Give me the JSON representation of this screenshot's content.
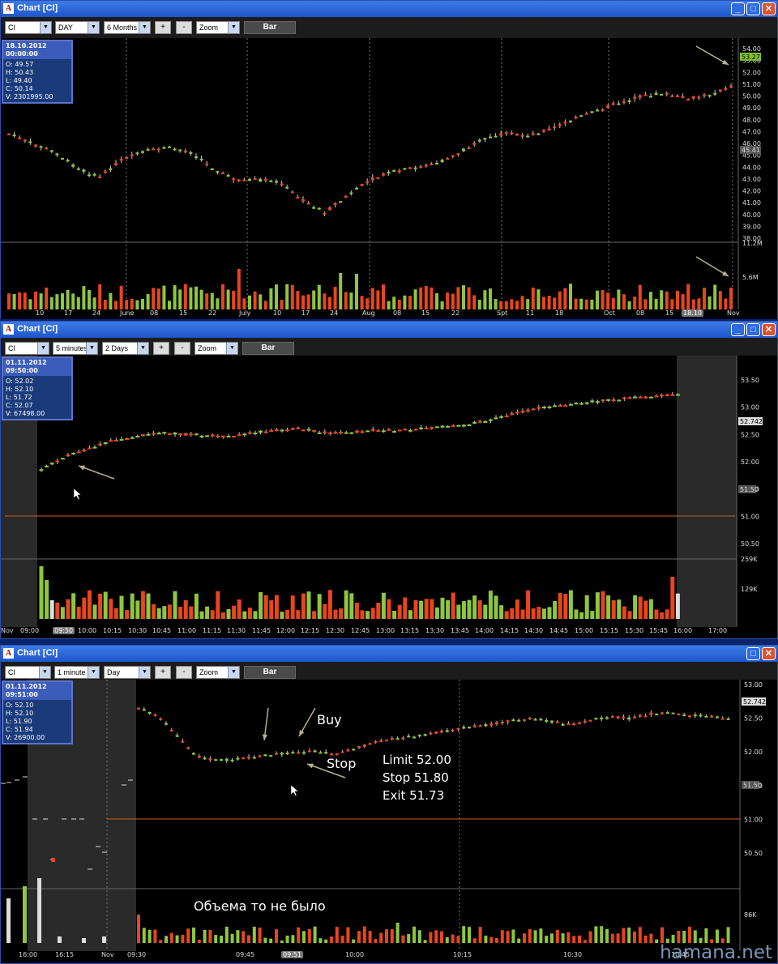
{
  "windows": [
    {
      "title": "Chart [CI]",
      "symbol": "CI",
      "period": "DAY",
      "range": "6 Months",
      "plus": "+",
      "minus": "-",
      "zoom": "Zoom",
      "bar": "Bar",
      "info": {
        "date": "18.10.2012 00:00:00",
        "o": "O: 49.57",
        "h": "H: 50.43",
        "l": "L: 49.40",
        "c": "C: 50.14",
        "v": "V: 2301995.00"
      },
      "y_labels": [
        "54.00",
        "53.00",
        "52.00",
        "51.00",
        "50.00",
        "49.00",
        "48.00",
        "47.00",
        "46.00",
        "45.00",
        "44.00",
        "43.00",
        "42.00",
        "41.00",
        "40.00",
        "39.00",
        "38.00"
      ],
      "price_tag": "53.27",
      "gray_tag": "45.41",
      "vol_labels": [
        "11.2M",
        "5.6M"
      ],
      "x_labels": [
        "10",
        "17",
        "24",
        "June",
        "08",
        "15",
        "22",
        "July",
        "10",
        "17",
        "24",
        "Aug",
        "08",
        "15",
        "22",
        "Spt",
        "11",
        "18",
        "Oct",
        "08",
        "15",
        "18.10",
        "Nov"
      ]
    },
    {
      "title": "Chart [CI]",
      "symbol": "CI",
      "period": "5 minutes",
      "range": "2 Days",
      "plus": "+",
      "minus": "-",
      "zoom": "Zoom",
      "bar": "Bar",
      "info": {
        "date": "01.11.2012 09:50:00",
        "o": "O: 52.02",
        "h": "H: 52.10",
        "l": "L: 51.72",
        "c": "C: 52.07",
        "v": "V: 67498.00"
      },
      "y_labels": [
        "53.50",
        "53.00",
        "52.50",
        "52.00",
        "51.50",
        "51.00",
        "50.50"
      ],
      "price_tag": "52.7427",
      "gray_tag": "51.50",
      "vol_labels": [
        "259K",
        "129K"
      ],
      "x_labels": [
        "Nov",
        "09:00",
        "09:50",
        "10:00",
        "10:15",
        "10:30",
        "10:45",
        "11:00",
        "11:15",
        "11:30",
        "11:45",
        "12:00",
        "12:15",
        "12:30",
        "12:45",
        "13:00",
        "13:15",
        "13:30",
        "13:45",
        "14:00",
        "14:15",
        "14:30",
        "14:45",
        "15:00",
        "15:15",
        "15:30",
        "15:45",
        "16:00",
        "17:00"
      ]
    },
    {
      "title": "Chart [CI]",
      "symbol": "CI",
      "period": "1 minute",
      "range": "Day",
      "plus": "+",
      "minus": "-",
      "zoom": "Zoom",
      "bar": "Bar",
      "info": {
        "date": "01.11.2012 09:51:00",
        "o": "O: 52.10",
        "h": "H: 52.10",
        "l": "L: 51.90",
        "c": "C: 51.94",
        "v": "V: 26900.00"
      },
      "y_labels": [
        "53.00",
        "52.50",
        "52.00",
        "51.50",
        "51.00",
        "50.50"
      ],
      "price_tag": "52.7427",
      "gray_tag": "51.50",
      "vol_labels": [
        "86K"
      ],
      "x_labels": [
        "16:00",
        "16:15",
        "Nov",
        "09:30",
        "09:45",
        "09:51",
        "10:00",
        "10:15",
        "10:30",
        "10:45"
      ],
      "notes": {
        "buy": "Buy",
        "stop": "Stop",
        "limit": "Limit 52.00",
        "stop_level": "Stop 51.80",
        "exit": "Exit 51.73",
        "volume_note": "Объема то не было"
      }
    }
  ],
  "watermark": "hamana.net",
  "colors": {
    "up": "#8ec63f",
    "down": "#e8461e",
    "grid": "#555555",
    "line": "#c8641e"
  }
}
